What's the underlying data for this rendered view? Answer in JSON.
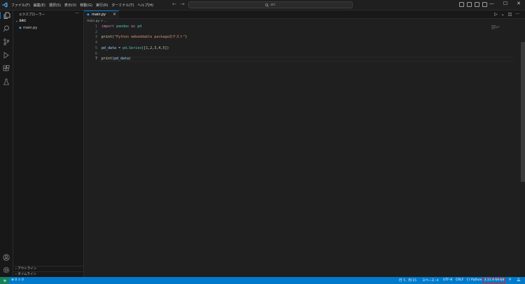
{
  "menu": [
    "ファイル(F)",
    "編集(E)",
    "選択(S)",
    "表示(V)",
    "移動(G)",
    "実行(R)",
    "ターミナル(T)",
    "ヘルプ(H)"
  ],
  "search": {
    "text": "src"
  },
  "sidebar": {
    "title": "エクスプローラー",
    "folder": "SRC",
    "files": [
      "main.py"
    ],
    "outline": "アウトライン",
    "timeline": "タイムライン"
  },
  "tab": {
    "label": "main.py",
    "close": "×"
  },
  "breadcrumb": "main.py > ...",
  "editor": {
    "line_numbers": [
      "1",
      "2",
      "3",
      "4",
      "5",
      "6",
      "7"
    ],
    "lines": [
      "import pandas as pd",
      "",
      "print(\"Python embeddable packageのテスト\")",
      "",
      "pd_data = pd.Series([1,2,3,4,5])",
      "",
      "print(pd_data)"
    ],
    "current_line": 7
  },
  "statusbar": {
    "problems": "⊗ 0  ⚠ 0",
    "position": "行 7、列 15",
    "spaces": "スペース: 4",
    "encoding": "UTF-8",
    "eol": "CRLF",
    "language": "Python",
    "interpreter": "3.11.4 64-bit"
  },
  "icons": {
    "explorer": "files-icon",
    "search": "search-icon",
    "scm": "source-control-icon",
    "run": "run-debug-icon",
    "extensions": "extensions-icon",
    "testing": "flask-icon",
    "account": "account-icon",
    "manage": "gear-icon"
  },
  "colors": {
    "statusbar": "#007acc",
    "accent": "#0078d4",
    "highlight_border": "#e02020"
  }
}
